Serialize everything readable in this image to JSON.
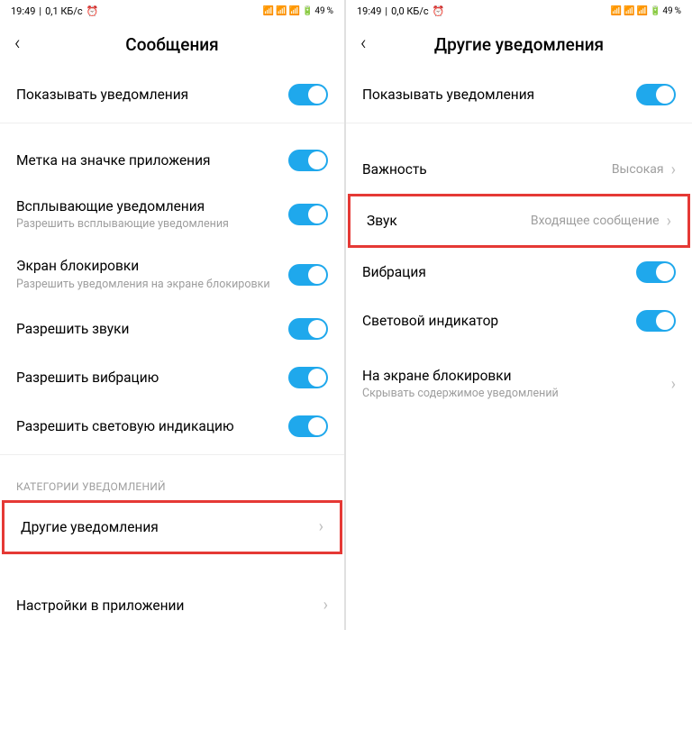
{
  "statusbar": {
    "time": "19:49",
    "speed_left": "0,1 КБ/с",
    "speed_right": "0,0 КБ/с",
    "alarm": "⏰",
    "battery_pct": "49",
    "battery_suffix": "%"
  },
  "left": {
    "title": "Сообщения",
    "show_notifications": "Показывать уведомления",
    "badge": "Метка на значке приложения",
    "popup_label": "Всплывающие уведомления",
    "popup_sub": "Разрешить всплывающие уведомления",
    "lockscreen_label": "Экран блокировки",
    "lockscreen_sub": "Разрешить уведомления на экране блокировки",
    "allow_sound": "Разрешить звуки",
    "allow_vibration": "Разрешить вибрацию",
    "allow_light": "Разрешить световую индикацию",
    "section_categories": "КАТЕГОРИИ УВЕДОМЛЕНИЙ",
    "other_notifications": "Другие уведомления",
    "app_settings": "Настройки в приложении"
  },
  "right": {
    "title": "Другие уведомления",
    "show_notifications": "Показывать уведомления",
    "importance_label": "Важность",
    "importance_value": "Высокая",
    "sound_label": "Звук",
    "sound_value": "Входящее сообщение",
    "vibration": "Вибрация",
    "light": "Световой индикатор",
    "lockscreen_label": "На экране блокировки",
    "lockscreen_sub": "Скрывать содержимое уведомлений"
  }
}
